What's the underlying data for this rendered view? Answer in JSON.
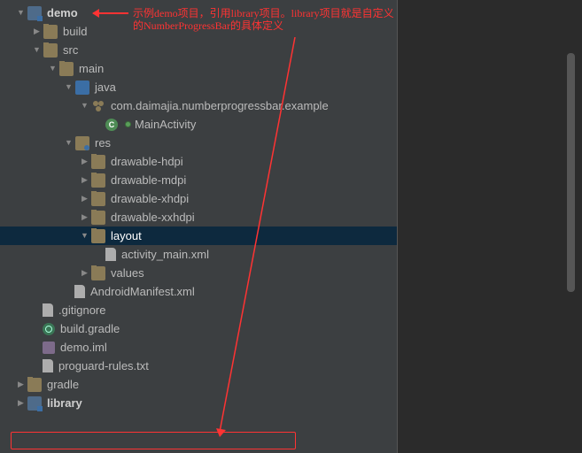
{
  "annotation": {
    "text": "示例demo项目，引用library项目。library项目就是自定义的NumberProgressBar的具体定义"
  },
  "tree": {
    "demo": "demo",
    "build": "build",
    "src": "src",
    "main": "main",
    "java": "java",
    "package": "com.daimajia.numberprogressbar.example",
    "mainActivity": "MainActivity",
    "res": "res",
    "drawable_hdpi": "drawable-hdpi",
    "drawable_mdpi": "drawable-mdpi",
    "drawable_xhdpi": "drawable-xhdpi",
    "drawable_xxhdpi": "drawable-xxhdpi",
    "layout": "layout",
    "activity_main": "activity_main.xml",
    "values": "values",
    "manifest": "AndroidManifest.xml",
    "gitignore": ".gitignore",
    "build_gradle": "build.gradle",
    "demo_iml": "demo.iml",
    "proguard": "proguard-rules.txt",
    "gradle": "gradle",
    "library": "library"
  }
}
